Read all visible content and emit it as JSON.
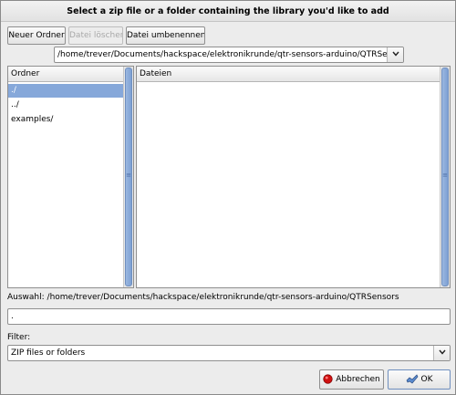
{
  "dialog": {
    "title": "Select a zip file or a folder containing the library you'd like to add"
  },
  "toolbar": {
    "new_folder": "Neuer Ordner",
    "delete_file": "Datei löschen",
    "rename_file": "Datei umbenennen"
  },
  "path_combo": {
    "value": "/home/trever/Documents/hackspace/elektronikrunde/qtr-sensors-arduino/QTRSensors",
    "arrow_icon": "chevron-down-icon"
  },
  "folders": {
    "header": "Ordner",
    "items": [
      "./",
      "../",
      "examples/"
    ],
    "selected_index": 0
  },
  "files": {
    "header": "Dateien",
    "items": []
  },
  "selection": {
    "label": "Auswahl:",
    "path": "/home/trever/Documents/hackspace/elektronikrunde/qtr-sensors-arduino/QTRSensors",
    "entry_value": "."
  },
  "filter": {
    "label": "Filter:",
    "value": "ZIP files or folders"
  },
  "actions": {
    "cancel": "Abbrechen",
    "ok": "OK",
    "cancel_icon": "stop-icon",
    "ok_icon": "ok-hand-icon"
  },
  "colors": {
    "selection_blue": "#86a8da",
    "scroll_blue": "#7ea1d4",
    "cancel_red": "#d01010"
  }
}
